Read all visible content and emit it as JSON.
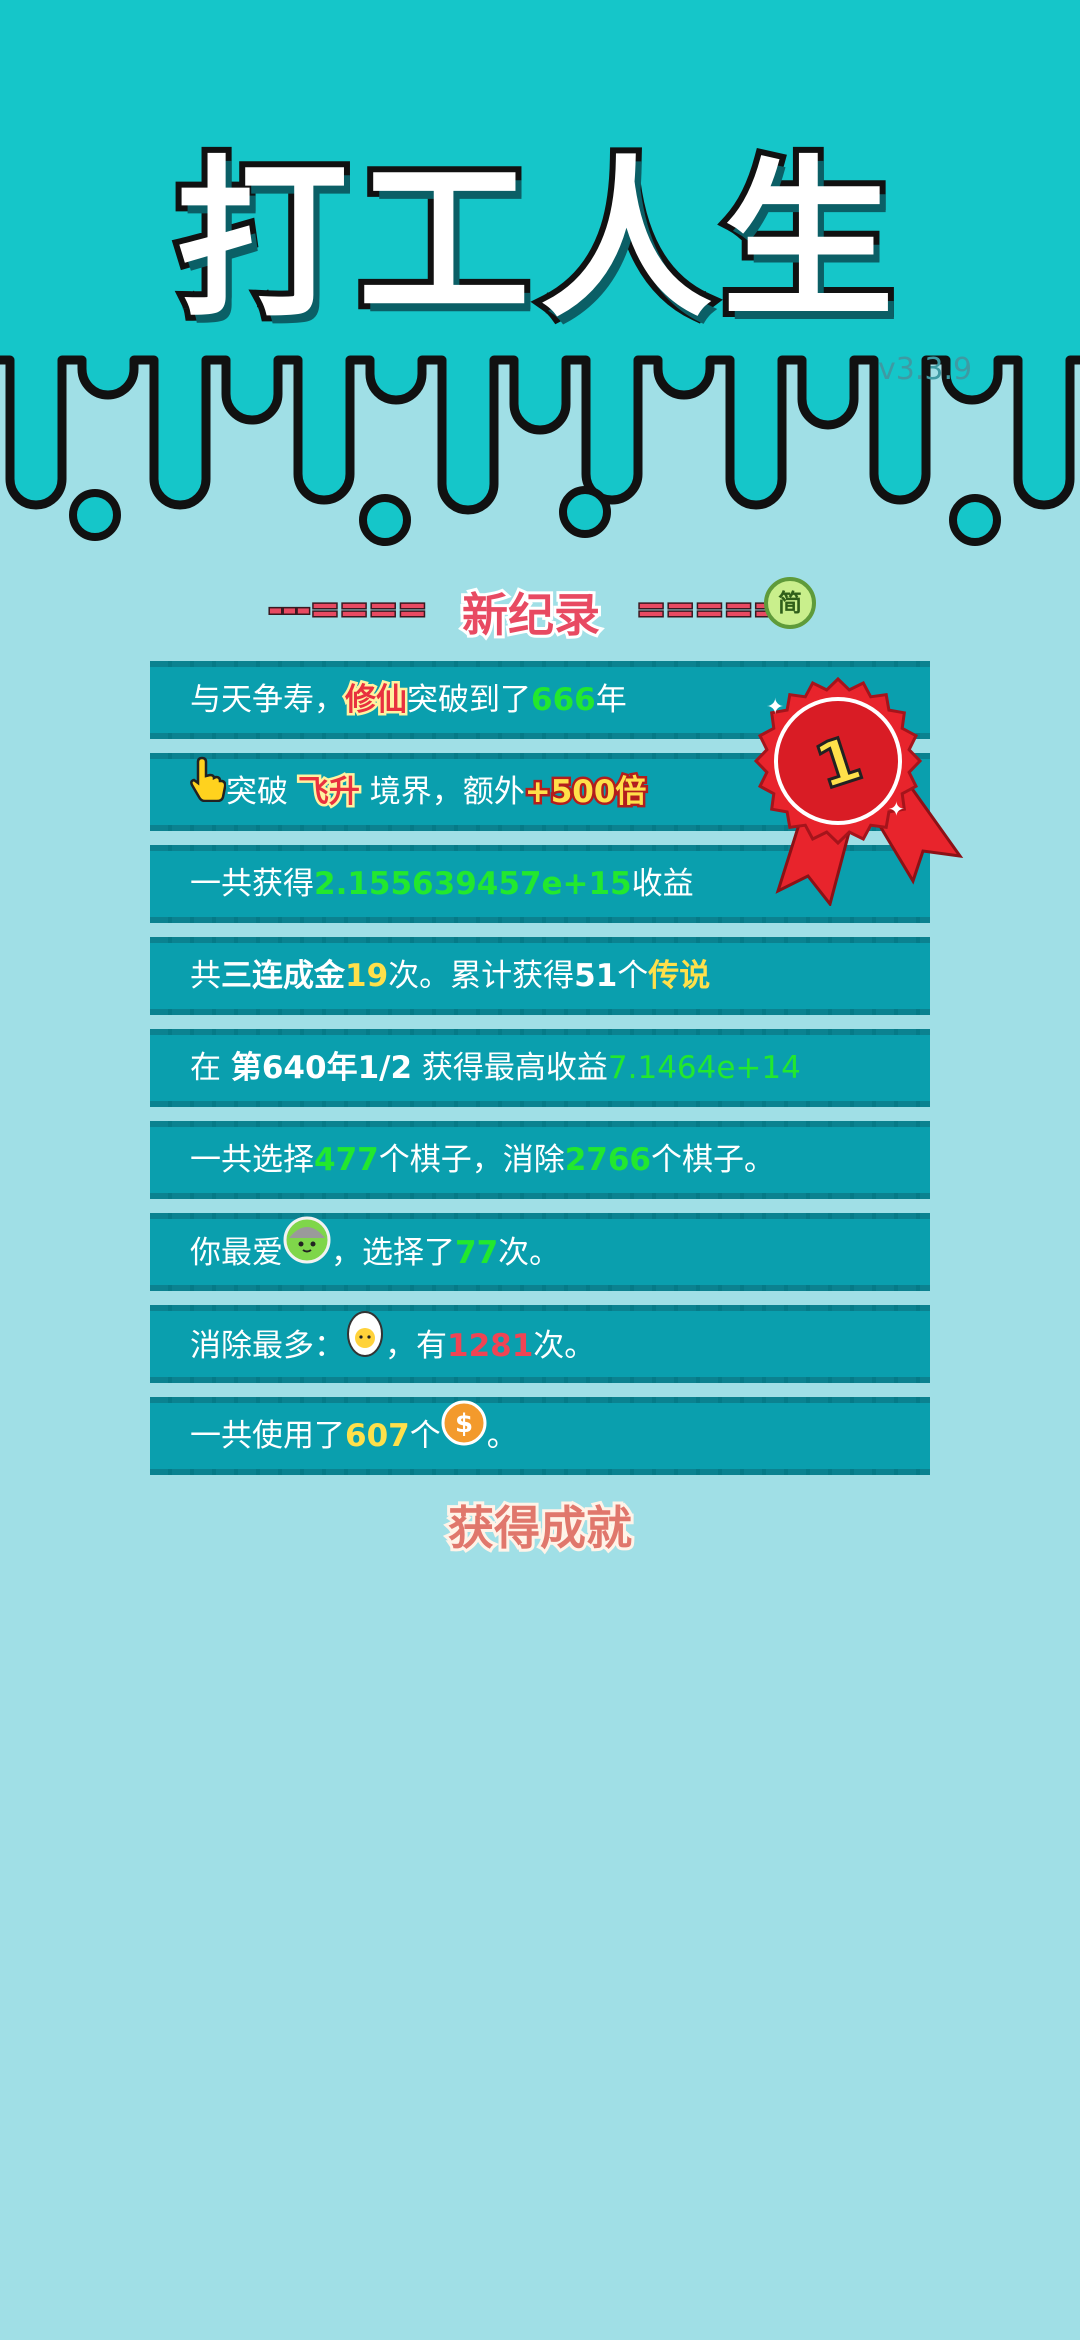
{
  "app": {
    "title": "打工人生",
    "version": "v3.3.9"
  },
  "banner": {
    "left_dashes": "---====",
    "label": "新纪录",
    "right_dashes": "=====-",
    "lang_button": "简"
  },
  "badge": {
    "rank": "1"
  },
  "records": [
    {
      "parts": [
        {
          "t": "与天争寿，"
        },
        {
          "t": "修仙",
          "s": "tag"
        },
        {
          "t": "突破到了"
        },
        {
          "t": "666",
          "s": "green"
        },
        {
          "t": "年"
        }
      ]
    },
    {
      "icon": "pointing-hand-icon",
      "parts": [
        {
          "t": "突破 "
        },
        {
          "t": "飞升",
          "s": "tag"
        },
        {
          "t": " 境界，额外"
        },
        {
          "t": "+500倍",
          "s": "tag-yellow"
        }
      ]
    },
    {
      "parts": [
        {
          "t": "一共获得"
        },
        {
          "t": "2.155639457e+15",
          "s": "green"
        },
        {
          "t": "收益"
        }
      ]
    },
    {
      "parts": [
        {
          "t": "共"
        },
        {
          "t": "三连成金",
          "s": "b"
        },
        {
          "t": "19",
          "s": "yellow"
        },
        {
          "t": "次。累计获得"
        },
        {
          "t": "51",
          "s": "b"
        },
        {
          "t": "个"
        },
        {
          "t": "传说",
          "s": "yellow"
        }
      ]
    },
    {
      "parts": [
        {
          "t": "在 "
        },
        {
          "t": "第640年1/2",
          "s": "b"
        },
        {
          "t": " 获得最高收益"
        },
        {
          "t": "7.1464e+14",
          "s": "thin"
        }
      ]
    },
    {
      "parts": [
        {
          "t": "一共选择"
        },
        {
          "t": "477",
          "s": "green"
        },
        {
          "t": "个棋子，消除"
        },
        {
          "t": "2766",
          "s": "green"
        },
        {
          "t": "个棋子。"
        }
      ]
    },
    {
      "parts": [
        {
          "t": "你最爱"
        },
        {
          "icon": "green-blob-icon"
        },
        {
          "t": "，选择了"
        },
        {
          "t": "77",
          "s": "green"
        },
        {
          "t": "次。"
        }
      ]
    },
    {
      "parts": [
        {
          "t": "消除最多："
        },
        {
          "icon": "egg-icon"
        },
        {
          "t": "，有"
        },
        {
          "t": "1281",
          "s": "red"
        },
        {
          "t": "次。"
        }
      ]
    },
    {
      "parts": [
        {
          "t": "一共使用了"
        },
        {
          "t": "607",
          "s": "yellow"
        },
        {
          "t": "个"
        },
        {
          "icon": "coin-icon"
        },
        {
          "t": "。"
        }
      ]
    }
  ],
  "achievement_button": "获得成就"
}
